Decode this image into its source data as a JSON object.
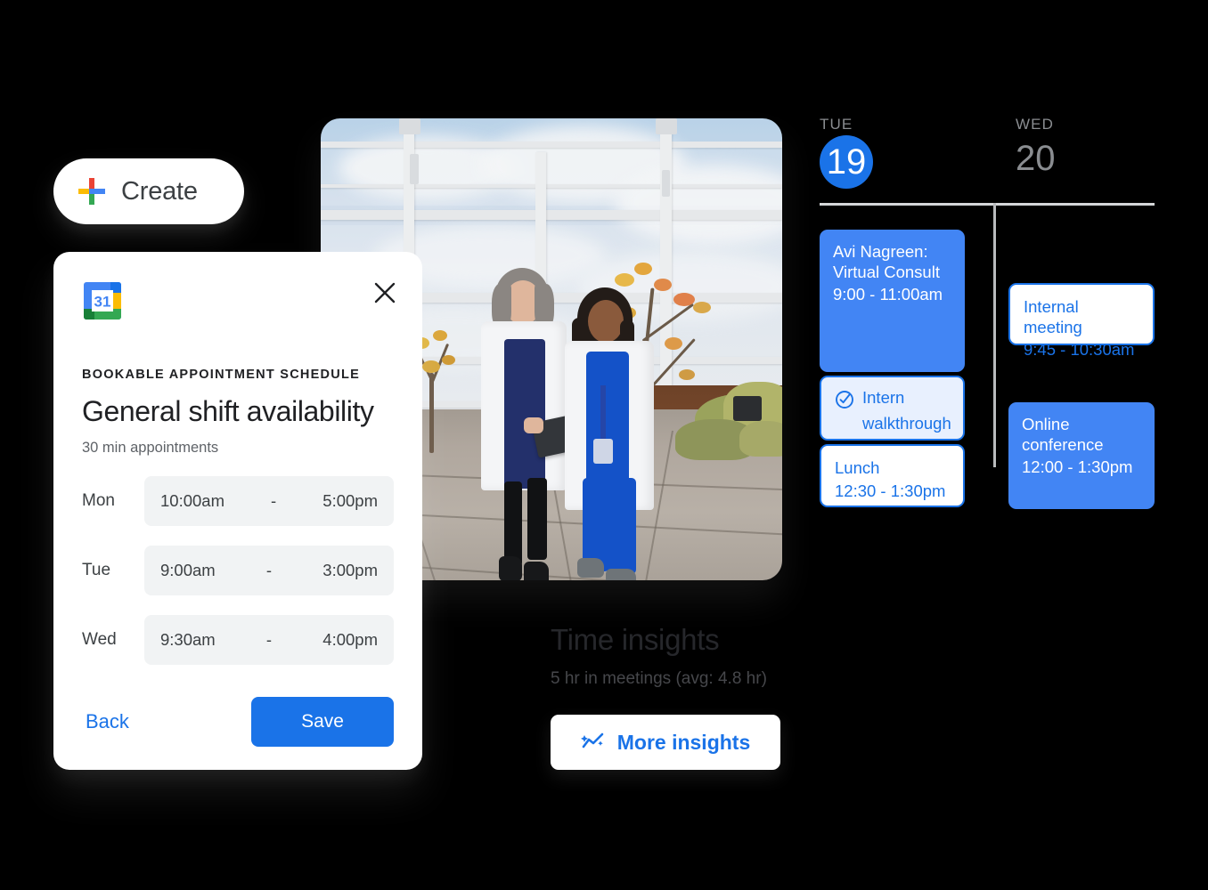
{
  "create_button": {
    "label": "Create",
    "icon": "google-plus-icon"
  },
  "dialog": {
    "icon": "google-calendar-icon",
    "close_icon": "close-icon",
    "eyebrow": "BOOKABLE APPOINTMENT SCHEDULE",
    "title": "General shift availability",
    "subtitle": "30 min appointments",
    "schedule": [
      {
        "day": "Mon",
        "start": "10:00am",
        "dash": "-",
        "end": "5:00pm"
      },
      {
        "day": "Tue",
        "start": "9:00am",
        "dash": "-",
        "end": "3:00pm"
      },
      {
        "day": "Wed",
        "start": "9:30am",
        "dash": "-",
        "end": "4:00pm"
      }
    ],
    "back_label": "Back",
    "save_label": "Save"
  },
  "photo": {
    "alt": "two healthcare workers in white coats walking outdoors looking at a tablet"
  },
  "insights": {
    "title": "Time insights",
    "subtitle": "5 hr in meetings (avg: 4.8 hr)",
    "button_label": "More insights",
    "button_icon": "insights-sparkle-icon"
  },
  "calendar": {
    "columns": [
      {
        "dow": "TUE",
        "day": "19",
        "today": true
      },
      {
        "dow": "WED",
        "day": "20",
        "today": false
      }
    ],
    "events": [
      {
        "title": "Avi Nagreen:",
        "title2": "Virtual Consult",
        "time": "9:00 - 11:00am",
        "style": "solid",
        "column": "tue",
        "icon": null
      },
      {
        "title": "Intern",
        "title2": "walkthrough",
        "time": "",
        "style": "tint",
        "column": "tue",
        "icon": "check-circle-icon"
      },
      {
        "title": "Lunch",
        "title2": "",
        "time": "12:30 - 1:30pm",
        "style": "outline",
        "column": "tue",
        "icon": null
      },
      {
        "title": "Internal meeting",
        "title2": "",
        "time": "9:45 - 10:30am",
        "style": "outline",
        "column": "wed",
        "icon": null
      },
      {
        "title": "Online",
        "title2": "conference",
        "time": "12:00 - 1:30pm",
        "style": "solid",
        "column": "wed",
        "icon": null
      }
    ]
  },
  "colors": {
    "background": "#000000",
    "google_blue": "#1a73e8",
    "event_blue": "#4285f4",
    "event_tint": "#e8f0fe",
    "google_red": "#ea4335",
    "google_yellow": "#fbbc04",
    "google_green": "#34a853",
    "surface": "#ffffff",
    "field_grey": "#f1f3f4"
  }
}
